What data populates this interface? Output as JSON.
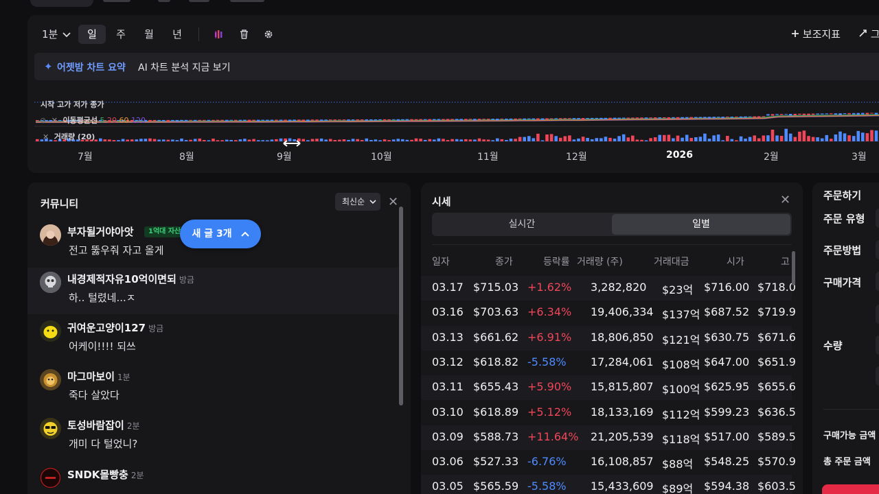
{
  "toolbar": {
    "interval": "1분",
    "periods": [
      "일",
      "주",
      "월",
      "년"
    ],
    "active_period": "일",
    "indicator_label": "보조지표",
    "expand_label": "그"
  },
  "ai_banner": {
    "title": "어젯밤 차트 요약",
    "text": "AI 차트 분석 지금 보기"
  },
  "chart": {
    "legend_price": "시작 고가 저가 종가",
    "legend_ma_label": "이동평균선",
    "ma_periods": [
      "5",
      "20",
      "60",
      "120"
    ],
    "legend_volume": "거래량 (20)",
    "x_labels": [
      "7월",
      "8월",
      "9월",
      "10월",
      "11월",
      "12월",
      "2026",
      "2월",
      "3월"
    ],
    "colors": {
      "up": "#f0465a",
      "down": "#4f8bff",
      "ma5": "#3aa86b",
      "ma20": "#d2455a",
      "ma60": "#e39a2e",
      "ma120": "#7a55d8"
    }
  },
  "community": {
    "title": "커뮤니티",
    "sort_label": "최신순",
    "new_posts_label": "새 글 3개",
    "posts": [
      {
        "author": "부자될거야아앗",
        "time": "",
        "badge": "1억대 자산가",
        "text": "전고 뚫우줘 자고 올게"
      },
      {
        "author": "내경제적자유10억이면되",
        "time": "방금",
        "badge": "",
        "text": "하.. 털렸네...ㅈ"
      },
      {
        "author": "귀여운고양이127",
        "time": "방금",
        "badge": "",
        "text": "어케이!!!! 되쓰"
      },
      {
        "author": "마그마보이",
        "time": "1분",
        "badge": "",
        "text": "죽다 살았다"
      },
      {
        "author": "토성바람잡이",
        "time": "2분",
        "badge": "",
        "text": "개미 다 털었니?"
      },
      {
        "author": "SNDK몰빵충",
        "time": "2분",
        "badge": "",
        "text": ""
      }
    ]
  },
  "quote": {
    "title": "시세",
    "tabs": [
      "실시간",
      "일별"
    ],
    "active_tab": "일별",
    "columns": [
      "일자",
      "종가",
      "등락률",
      "거래량 (주)",
      "거래대금",
      "시가",
      "고"
    ],
    "rows": [
      {
        "date": "03.17",
        "close": "$715.03",
        "change": "+1.62%",
        "dir": "up",
        "volume": "3,282,820",
        "amount": "$23억",
        "open": "$716.00",
        "high": "$718.0"
      },
      {
        "date": "03.16",
        "close": "$703.63",
        "change": "+6.34%",
        "dir": "up",
        "volume": "19,406,334",
        "amount": "$137억",
        "open": "$687.52",
        "high": "$719.9"
      },
      {
        "date": "03.13",
        "close": "$661.62",
        "change": "+6.91%",
        "dir": "up",
        "volume": "18,806,850",
        "amount": "$121억",
        "open": "$630.75",
        "high": "$671.6"
      },
      {
        "date": "03.12",
        "close": "$618.82",
        "change": "-5.58%",
        "dir": "down",
        "volume": "17,284,061",
        "amount": "$108억",
        "open": "$647.00",
        "high": "$651.9"
      },
      {
        "date": "03.11",
        "close": "$655.43",
        "change": "+5.90%",
        "dir": "up",
        "volume": "15,815,807",
        "amount": "$100억",
        "open": "$625.95",
        "high": "$655.6"
      },
      {
        "date": "03.10",
        "close": "$618.89",
        "change": "+5.12%",
        "dir": "up",
        "volume": "18,133,169",
        "amount": "$112억",
        "open": "$599.23",
        "high": "$636.5"
      },
      {
        "date": "03.09",
        "close": "$588.73",
        "change": "+11.64%",
        "dir": "up",
        "volume": "21,205,539",
        "amount": "$118억",
        "open": "$517.00",
        "high": "$589.5"
      },
      {
        "date": "03.06",
        "close": "$527.33",
        "change": "-6.76%",
        "dir": "down",
        "volume": "16,108,857",
        "amount": "$88억",
        "open": "$548.25",
        "high": "$570.9"
      },
      {
        "date": "03.05",
        "close": "$565.59",
        "change": "-5.58%",
        "dir": "down",
        "volume": "15,433,609",
        "amount": "$89억",
        "open": "$594.38",
        "high": "$603.5"
      }
    ]
  },
  "order": {
    "title": "주문하기",
    "labels": [
      "주문 유형",
      "주문방법",
      "구매가격",
      "수량"
    ],
    "available_label": "구매가능 금액",
    "total_label": "총 주문 금액"
  }
}
